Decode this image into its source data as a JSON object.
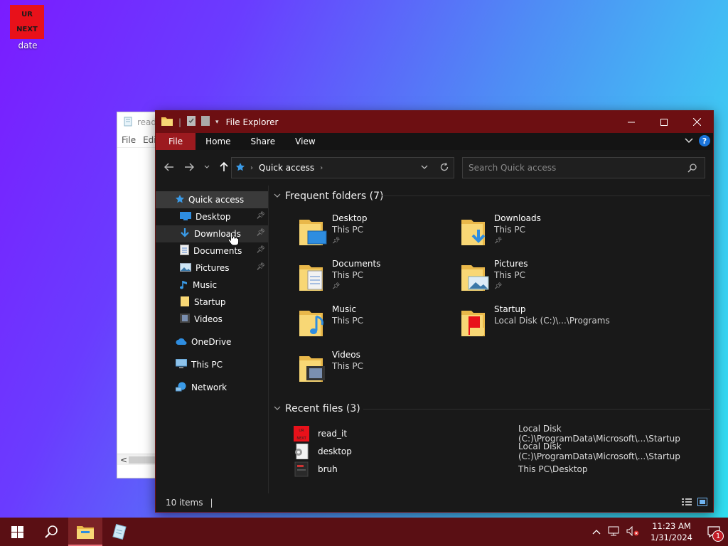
{
  "desktop": {
    "icon": {
      "label": "date",
      "img_text_top": "UR",
      "img_text_bottom": "NEXT",
      "icon_name": "red-image-file-icon"
    }
  },
  "notepad": {
    "title": "read_",
    "menu": [
      "File",
      "Edi"
    ],
    "scroll_left": "<"
  },
  "explorer": {
    "title": "File Explorer",
    "ribbon_tabs": [
      "File",
      "Home",
      "Share",
      "View"
    ],
    "address": {
      "root_icon": "star-icon",
      "path": "Quick access"
    },
    "search_placeholder": "Search Quick access",
    "nav": [
      {
        "label": "Quick access",
        "icon": "star-icon",
        "level": 1
      },
      {
        "label": "Desktop",
        "icon": "desktop-icon",
        "level": 2,
        "pinned": true
      },
      {
        "label": "Downloads",
        "icon": "download-icon",
        "level": 2,
        "pinned": true,
        "hover": true
      },
      {
        "label": "Documents",
        "icon": "documents-icon",
        "level": 2,
        "pinned": true
      },
      {
        "label": "Pictures",
        "icon": "pictures-icon",
        "level": 2,
        "pinned": true
      },
      {
        "label": "Music",
        "icon": "music-icon",
        "level": 2
      },
      {
        "label": "Startup",
        "icon": "folder-icon",
        "level": 2
      },
      {
        "label": "Videos",
        "icon": "videos-icon",
        "level": 2
      },
      {
        "label": "OneDrive",
        "icon": "cloud-icon",
        "level": 1
      },
      {
        "label": "This PC",
        "icon": "computer-icon",
        "level": 1
      },
      {
        "label": "Network",
        "icon": "network-icon",
        "level": 1
      }
    ],
    "frequent_header": "Frequent folders (7)",
    "folders": [
      {
        "name": "Desktop",
        "location": "This PC",
        "pinned": true,
        "overlay": "desktop"
      },
      {
        "name": "Downloads",
        "location": "This PC",
        "pinned": true,
        "overlay": "download"
      },
      {
        "name": "Documents",
        "location": "This PC",
        "pinned": true,
        "overlay": "document"
      },
      {
        "name": "Pictures",
        "location": "This PC",
        "pinned": true,
        "overlay": "picture"
      },
      {
        "name": "Music",
        "location": "This PC",
        "pinned": false,
        "overlay": "music"
      },
      {
        "name": "Startup",
        "location": "Local Disk (C:)\\...\\Programs",
        "pinned": false,
        "overlay": "startup"
      },
      {
        "name": "Videos",
        "location": "This PC",
        "pinned": false,
        "overlay": "video"
      }
    ],
    "recent_header": "Recent files (3)",
    "recent": [
      {
        "name": "read_it",
        "location": "Local Disk (C:)\\ProgramData\\Microsoft\\...\\Startup",
        "icon": "red-image-file-icon"
      },
      {
        "name": "desktop",
        "location": "Local Disk (C:)\\ProgramData\\Microsoft\\...\\Startup",
        "icon": "settings-file-icon"
      },
      {
        "name": "bruh",
        "location": "This PC\\Desktop",
        "icon": "dark-image-file-icon"
      }
    ],
    "status": "10 items"
  },
  "taskbar": {
    "time": "11:23 AM",
    "date": "1/31/2024",
    "notification_count": "1"
  },
  "colors": {
    "titlebar": "#6d0f12",
    "file_tab": "#9c1a1f",
    "taskbar": "#5a0f14",
    "explorer_bg": "#191919"
  }
}
